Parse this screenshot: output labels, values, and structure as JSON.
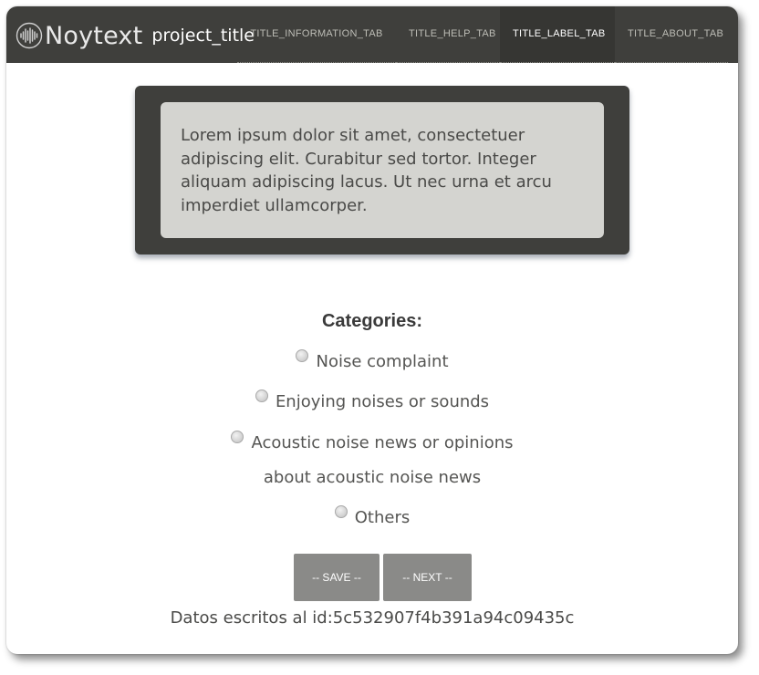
{
  "header": {
    "brand_name": "Noytext",
    "project_title": "project_title",
    "logo_icon": "sound-wave-icon",
    "tabs": [
      {
        "label": "TITLE_INFORMATION_TAB",
        "active": false
      },
      {
        "label": "TITLE_HELP_TAB",
        "active": false
      },
      {
        "label": "TITLE_LABEL_TAB",
        "active": true
      },
      {
        "label": "TITLE_ABOUT_TAB",
        "active": false
      }
    ]
  },
  "text_card": {
    "body": "Lorem ipsum dolor sit amet, consectetuer adipiscing elit. Curabitur sed tortor. Integer aliquam adipiscing lacus. Ut nec urna et arcu imperdiet ullamcorper."
  },
  "categories": {
    "title": "Categories:",
    "options": [
      {
        "label": "Noise complaint"
      },
      {
        "label": "Enjoying noises or sounds"
      },
      {
        "label": "Acoustic noise news or opinions",
        "label_line2": "about acoustic noise news"
      },
      {
        "label": "Others"
      }
    ]
  },
  "actions": {
    "save_label": "-- SAVE --",
    "next_label": "-- NEXT --"
  },
  "status_text": "Datos escritos al id:5c532907f4b391a94c09435c",
  "colors": {
    "navbar": "#3f3f3c",
    "card_outer": "#3f3f3c",
    "card_inner": "#d4d4d0",
    "button": "#8a8a88"
  }
}
